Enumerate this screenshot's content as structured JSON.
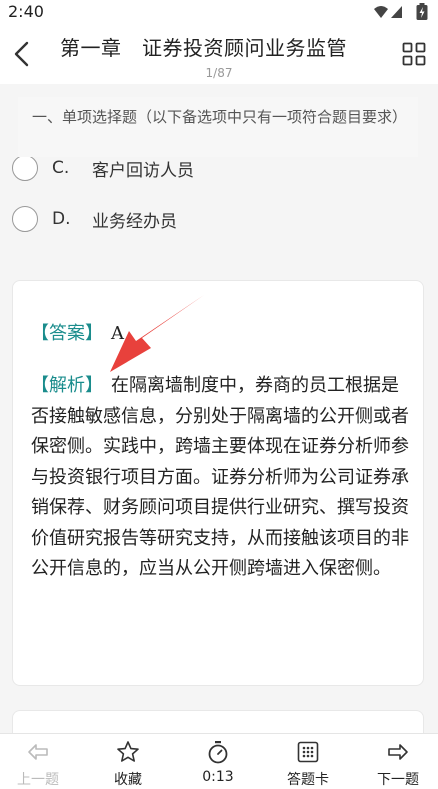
{
  "status": {
    "time": "2:40"
  },
  "header": {
    "title": "第一章　证券投资顾问业务监管",
    "page": "1/87"
  },
  "question_type": "一、单项选择题（以下备选项中只有一项符合题目要求）",
  "options": [
    {
      "letter": "C.",
      "text": "客户回访人员"
    },
    {
      "letter": "D.",
      "text": "业务经办员"
    }
  ],
  "answer": {
    "label": "【答案】",
    "value": "A"
  },
  "explanation": {
    "label": "【解析】",
    "text": "在隔离墙制度中，券商的员工根据是否接触敏感信息，分别处于隔离墙的公开侧或者保密侧。实践中，跨墙主要体现在证券分析师参与投资银行项目方面。证券分析师为公司证券承销保荐、财务顾问项目提供行业研究、撰写投资价值研究报告等研究支持，从而接触该项目的非公开信息的，应当从公开侧跨墙进入保密侧。"
  },
  "bottom_bar": {
    "prev": "上一题",
    "favorite": "收藏",
    "timer": "0:13",
    "answer_card": "答题卡",
    "next": "下一题"
  },
  "colors": {
    "accent": "#1a8c8c",
    "arrow": "#e8413c"
  }
}
